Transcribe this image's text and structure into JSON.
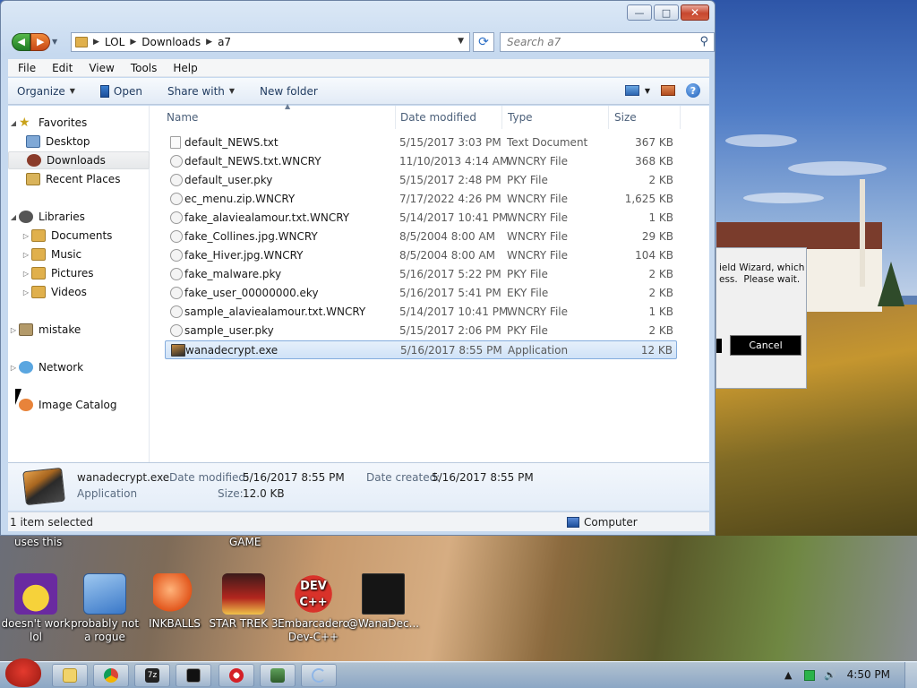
{
  "window": {
    "breadcrumbs": [
      "LOL",
      "Downloads",
      "a7"
    ],
    "search_placeholder": "Search a7"
  },
  "menubar": [
    "File",
    "Edit",
    "View",
    "Tools",
    "Help"
  ],
  "toolbar": {
    "organize": "Organize",
    "open": "Open",
    "share_with": "Share with",
    "new_folder": "New folder"
  },
  "nav": {
    "favorites": "Favorites",
    "desktop": "Desktop",
    "downloads": "Downloads",
    "recent_places": "Recent Places",
    "libraries": "Libraries",
    "documents": "Documents",
    "music": "Music",
    "pictures": "Pictures",
    "videos": "Videos",
    "mistake": "mistake",
    "network": "Network",
    "image_catalog": "Image Catalog"
  },
  "columns": {
    "name": "Name",
    "date_modified": "Date modified",
    "type": "Type",
    "size": "Size"
  },
  "files": [
    {
      "name": "default_NEWS.txt",
      "date": "5/15/2017 3:03 PM",
      "type": "Text Document",
      "size": "367 KB",
      "icon": "text-file-icon"
    },
    {
      "name": "default_NEWS.txt.WNCRY",
      "date": "11/10/2013 4:14 AM",
      "type": "WNCRY File",
      "size": "368 KB",
      "icon": "generic-file-icon"
    },
    {
      "name": "default_user.pky",
      "date": "5/15/2017 2:48 PM",
      "type": "PKY File",
      "size": "2 KB",
      "icon": "generic-file-icon"
    },
    {
      "name": "ec_menu.zip.WNCRY",
      "date": "7/17/2022 4:26 PM",
      "type": "WNCRY File",
      "size": "1,625 KB",
      "icon": "generic-file-icon"
    },
    {
      "name": "fake_alaviealamour.txt.WNCRY",
      "date": "5/14/2017 10:41 PM",
      "type": "WNCRY File",
      "size": "1 KB",
      "icon": "generic-file-icon"
    },
    {
      "name": "fake_Collines.jpg.WNCRY",
      "date": "8/5/2004 8:00 AM",
      "type": "WNCRY File",
      "size": "29 KB",
      "icon": "generic-file-icon"
    },
    {
      "name": "fake_Hiver.jpg.WNCRY",
      "date": "8/5/2004 8:00 AM",
      "type": "WNCRY File",
      "size": "104 KB",
      "icon": "generic-file-icon"
    },
    {
      "name": "fake_malware.pky",
      "date": "5/16/2017 5:22 PM",
      "type": "PKY File",
      "size": "2 KB",
      "icon": "generic-file-icon"
    },
    {
      "name": "fake_user_00000000.eky",
      "date": "5/16/2017 5:41 PM",
      "type": "EKY File",
      "size": "2 KB",
      "icon": "generic-file-icon"
    },
    {
      "name": "sample_alaviealamour.txt.WNCRY",
      "date": "5/14/2017 10:41 PM",
      "type": "WNCRY File",
      "size": "1 KB",
      "icon": "generic-file-icon"
    },
    {
      "name": "sample_user.pky",
      "date": "5/15/2017 2:06 PM",
      "type": "PKY File",
      "size": "2 KB",
      "icon": "generic-file-icon"
    },
    {
      "name": "wanadecrypt.exe",
      "date": "5/16/2017 8:55 PM",
      "type": "Application",
      "size": "12 KB",
      "icon": "application-icon",
      "selected": true
    }
  ],
  "details": {
    "name": "wanadecrypt.exe",
    "type": "Application",
    "date_modified_label": "Date modified:",
    "date_modified": "5/16/2017 8:55 PM",
    "date_created_label": "Date created:",
    "date_created": "5/16/2017 8:55 PM",
    "size_label": "Size:",
    "size": "12.0 KB"
  },
  "status": {
    "selected": "1 item selected",
    "location": "Computer"
  },
  "background_dialog": {
    "text": "ield Wizard, which\ness.  Please wait.",
    "cancel": "Cancel"
  },
  "desktop": {
    "top_labels": [
      "uses this",
      "GAME"
    ],
    "icons": [
      {
        "label": "doesn't work lol",
        "icon": "yahoo-messenger-icon"
      },
      {
        "label": "probably not a rogue",
        "icon": "settings-gears-icon"
      },
      {
        "label": "INKBALLS",
        "icon": "inkball-icon"
      },
      {
        "label": "STAR TREK 3",
        "icon": "star-trek-icon"
      },
      {
        "label": "Embarcadero Dev-C++",
        "icon": "dev-cpp-icon"
      },
      {
        "label": "@WanaDec...",
        "icon": "wanadecryptor-icon"
      }
    ]
  },
  "taskbar": {
    "items": [
      "explorer-icon",
      "chrome-icon",
      "7zip-icon",
      "cmd-icon",
      "opera-icon",
      "monitor-icon",
      "loading-icon"
    ],
    "clock": "4:50 PM"
  },
  "colors": {
    "accent": "#2d6fc6",
    "selection": "#cfe2f7",
    "close_button": "#c7472f"
  }
}
